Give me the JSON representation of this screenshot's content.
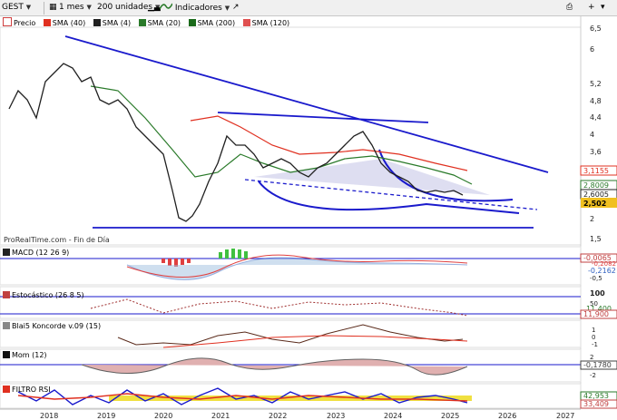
{
  "toolbar": {
    "ticker": "GEST",
    "period": "1 mes",
    "units": "200 unidades",
    "indicators_label": "Indicadores"
  },
  "main_legend": [
    {
      "label": "Precio",
      "color": "#d04040"
    },
    {
      "label": "SMA (40)",
      "color": "#e03020"
    },
    {
      "label": "SMA (4)",
      "color": "#202020"
    },
    {
      "label": "SMA (20)",
      "color": "#2a7a2a"
    },
    {
      "label": "SMA (200)",
      "color": "#1a6a1a"
    },
    {
      "label": "SMA (120)",
      "color": "#e05050"
    }
  ],
  "source_label": "ProRealTime.com - Fin de Día",
  "price_axis": [
    "6,5",
    "6",
    "5,2",
    "4,8",
    "4,4",
    "4",
    "3,6",
    "2",
    "1,5"
  ],
  "price_badges": {
    "sma120": "3,1155",
    "sma20": "2,8009",
    "sma4": "2,6005",
    "last": "2,502"
  },
  "panels": {
    "macd": {
      "label": "MACD (12 26 9)",
      "badges": [
        "-0,0065",
        "-0,2082",
        "-0,2162"
      ],
      "axis": [
        "0",
        "-0,5"
      ]
    },
    "stoch": {
      "label": "Estocástico (26 8 5)",
      "badges": [
        "11,400",
        "11,900"
      ],
      "axis": [
        "100",
        "50"
      ]
    },
    "koncorde": {
      "label": "Blai5 Koncorde v.09 (15)",
      "axis": [
        "1",
        "0",
        "-1"
      ]
    },
    "mom": {
      "label": "Mom (12)",
      "badges": [
        "-0,1780"
      ],
      "axis": [
        "2",
        "-2"
      ]
    },
    "rsi": {
      "label": "FILTRO RSI",
      "badges": [
        "42,953",
        "33,409"
      ]
    }
  },
  "x_axis": [
    "2018",
    "2019",
    "2020",
    "2021",
    "2022",
    "2023",
    "2024",
    "2025",
    "2026",
    "2027"
  ],
  "colors": {
    "trendline": "#1a1acc",
    "sma120": "#e03020",
    "sma20": "#2a7a2a",
    "price": "#202020",
    "last_badge": "#f0c020",
    "gridline": "#1a1acc"
  }
}
